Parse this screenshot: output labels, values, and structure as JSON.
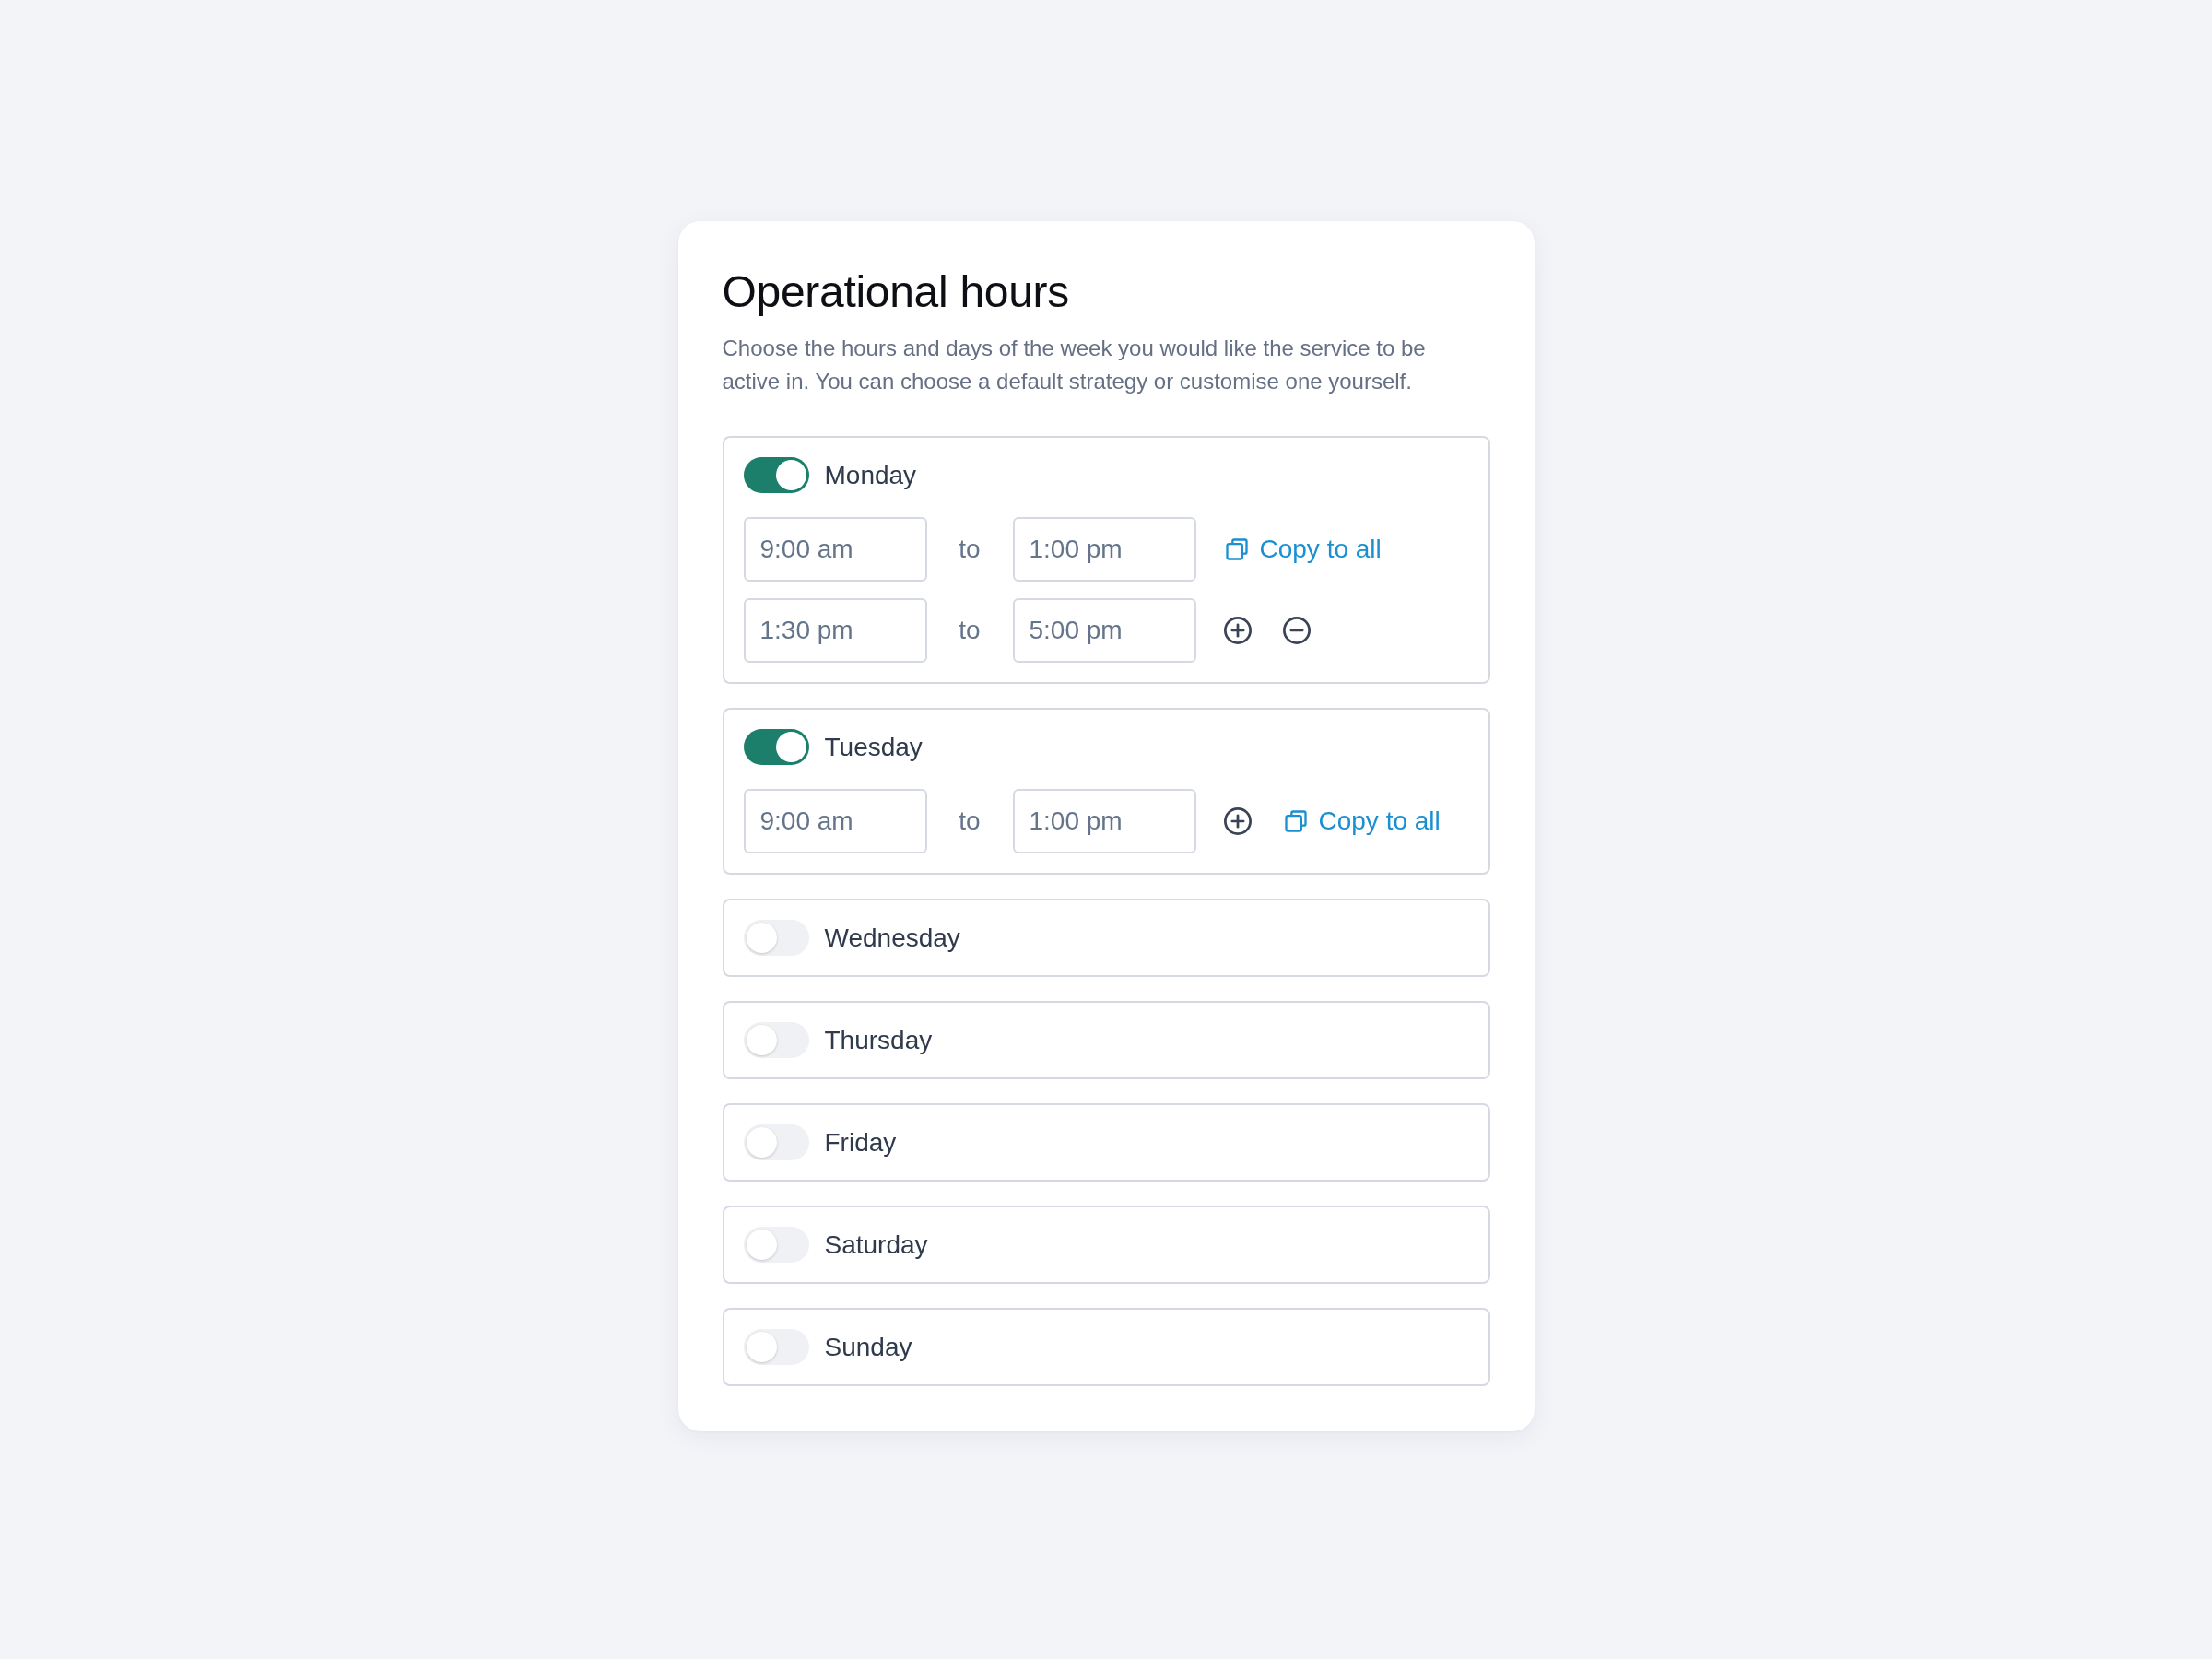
{
  "title": "Operational hours",
  "description": "Choose the hours and days of the week you would like the service to be active in. You can choose a default strategy or customise one yourself.",
  "days": [
    {
      "name": "Monday",
      "on": true,
      "ranges": [
        {
          "start": "9:00 am",
          "separator": "to",
          "end": "1:00 pm",
          "actions": [
            {
              "kind": "copy",
              "label": "Copy to all"
            }
          ]
        },
        {
          "start": "1:30 pm",
          "separator": "to",
          "end": "5:00 pm",
          "actions": [
            {
              "kind": "add"
            },
            {
              "kind": "remove"
            }
          ]
        }
      ]
    },
    {
      "name": "Tuesday",
      "on": true,
      "ranges": [
        {
          "start": "9:00 am",
          "separator": "to",
          "end": "1:00 pm",
          "actions": [
            {
              "kind": "add"
            },
            {
              "kind": "copy",
              "label": "Copy to all"
            }
          ]
        }
      ]
    },
    {
      "name": "Wednesday",
      "on": false
    },
    {
      "name": "Thursday",
      "on": false
    },
    {
      "name": "Friday",
      "on": false
    },
    {
      "name": "Saturday",
      "on": false
    },
    {
      "name": "Sunday",
      "on": false
    }
  ]
}
